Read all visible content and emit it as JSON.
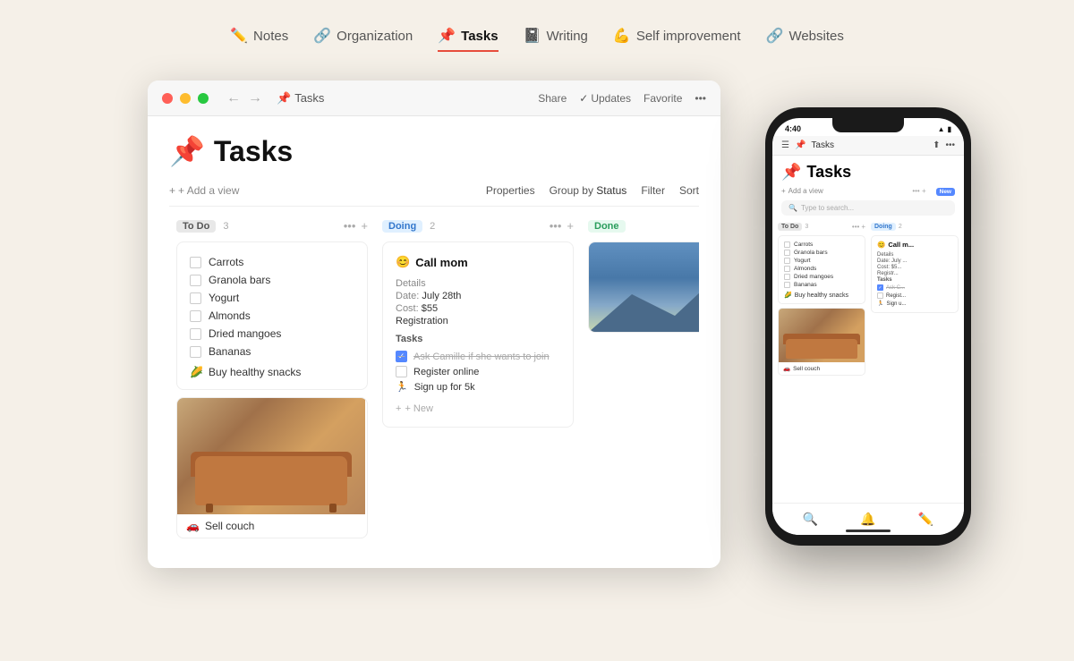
{
  "nav": {
    "tabs": [
      {
        "id": "notes",
        "emoji": "✏️",
        "label": "Notes",
        "active": false
      },
      {
        "id": "organization",
        "emoji": "🔗",
        "label": "Organization",
        "active": false
      },
      {
        "id": "tasks",
        "emoji": "📌",
        "label": "Tasks",
        "active": true
      },
      {
        "id": "writing",
        "emoji": "📓",
        "label": "Writing",
        "active": false
      },
      {
        "id": "self-improvement",
        "emoji": "💪",
        "label": "Self improvement",
        "active": false
      },
      {
        "id": "websites",
        "emoji": "🔗",
        "label": "Websites",
        "active": false
      }
    ]
  },
  "window": {
    "title": "Tasks",
    "title_emoji": "📌",
    "share_label": "Share",
    "updates_label": "Updates",
    "favorite_label": "Favorite",
    "add_view_label": "+ Add a view",
    "properties_label": "Properties",
    "group_by_label": "Group by",
    "group_by_value": "Status",
    "filter_label": "Filter",
    "sort_label": "Sort"
  },
  "kanban": {
    "columns": [
      {
        "id": "todo",
        "label": "To Do",
        "count": 3,
        "badge_type": "todo"
      },
      {
        "id": "doing",
        "label": "Doing",
        "count": 2,
        "badge_type": "doing"
      },
      {
        "id": "done",
        "label": "Done",
        "count": null,
        "badge_type": "done"
      }
    ],
    "todo_items": [
      {
        "label": "Carrots",
        "checked": false
      },
      {
        "label": "Granola bars",
        "checked": false
      },
      {
        "label": "Yogurt",
        "checked": false
      },
      {
        "label": "Almonds",
        "checked": false
      },
      {
        "label": "Dried mangoes",
        "checked": false
      },
      {
        "label": "Bananas",
        "checked": false
      }
    ],
    "healthy_snacks": "Buy healthy snacks",
    "healthy_snacks_emoji": "🌽",
    "sell_couch": "Sell couch",
    "sell_couch_emoji": "🚗",
    "doing_card": {
      "title": "Call mom",
      "emoji": "😊",
      "details_label": "Details",
      "date_label": "Date:",
      "date_value": "July 28th",
      "cost_label": "Cost:",
      "cost_value": "$55",
      "registration_label": "Registration",
      "tasks_label": "Tasks",
      "tasks": [
        {
          "label": "Ask Camille if she wants to join",
          "done": true
        },
        {
          "label": "Register online",
          "done": false
        },
        {
          "label": "Sign up for 5k",
          "done": false,
          "star": true
        }
      ],
      "sign_up_emoji": "🏃",
      "new_label": "+ New"
    }
  },
  "phone": {
    "time": "4:40",
    "title": "Tasks",
    "title_emoji": "📌",
    "search_placeholder": "Type to search...",
    "todo_label": "To Do",
    "todo_count": "3",
    "doing_label": "Doing",
    "doing_count": "2",
    "new_badge": "New",
    "checklist": [
      "Carrots",
      "Granola bars",
      "Yogurt",
      "Almonds",
      "Dried mangoes",
      "Bananas"
    ],
    "healthy_snacks": "Buy healthy snacks",
    "healthy_snacks_emoji": "🌽",
    "call_mom": "Call m...",
    "call_mom_emoji": "😊",
    "doing_details": "Details",
    "doing_date": "Date: July ...",
    "doing_cost": "Cost: $5...",
    "doing_registration": "Registr...",
    "tasks_label": "Tasks",
    "ask_task": "Ask C...",
    "register_task": "Regist...",
    "sign_task": "Sign u...",
    "sell_couch": "Sell couch",
    "sell_couch_emoji": "🚗"
  }
}
